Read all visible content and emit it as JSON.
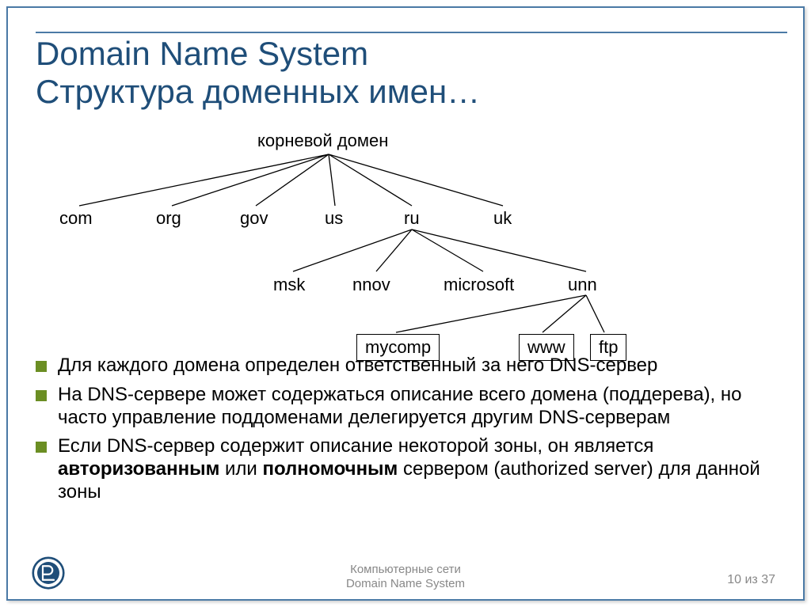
{
  "title": {
    "line1": "Domain Name System",
    "line2": "Структура доменных имен…"
  },
  "diagram": {
    "root": "корневой домен",
    "tlds": [
      "com",
      "org",
      "gov",
      "us",
      "ru",
      "uk"
    ],
    "level2": [
      "msk",
      "nnov",
      "microsoft",
      "unn"
    ],
    "level3": [
      "mycomp",
      "www",
      "ftp"
    ]
  },
  "bullets": [
    {
      "parts": [
        {
          "text": "Для каждого домена определен ответственный за него DNS-сервер",
          "bold": false
        }
      ]
    },
    {
      "parts": [
        {
          "text": "На DNS-сервере может содержаться описание всего домена (поддерева), но часто управление поддоменами делегируется другим DNS-серверам",
          "bold": false
        }
      ]
    },
    {
      "parts": [
        {
          "text": "Если DNS-сервер содержит описание некоторой зоны, он является ",
          "bold": false
        },
        {
          "text": "авторизованным",
          "bold": true
        },
        {
          "text": " или ",
          "bold": false
        },
        {
          "text": "полномочным",
          "bold": true
        },
        {
          "text": " сервером (authorized server) для данной зоны",
          "bold": false
        }
      ]
    }
  ],
  "footer": {
    "line1": "Компьютерные сети",
    "line2": "Domain Name System"
  },
  "page": "10 из 37"
}
